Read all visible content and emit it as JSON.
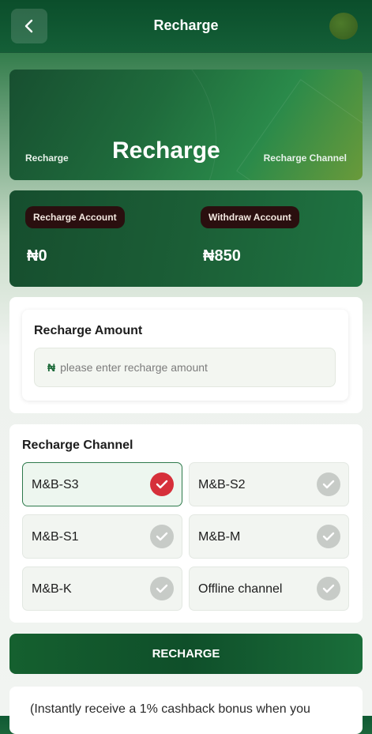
{
  "header": {
    "title": "Recharge"
  },
  "banner": {
    "left_label": "Recharge",
    "title": "Recharge",
    "right_label": "Recharge Channel"
  },
  "accounts": {
    "recharge": {
      "label": "Recharge Account",
      "value": "₦0"
    },
    "withdraw": {
      "label": "Withdraw Account",
      "value": "₦850"
    }
  },
  "amount": {
    "title": "Recharge Amount",
    "currency": "₦",
    "placeholder": "please enter recharge amount"
  },
  "channels": {
    "title": "Recharge Channel",
    "selected": "M&B-S3",
    "options": [
      {
        "label": "M&B-S3"
      },
      {
        "label": "M&B-S2"
      },
      {
        "label": "M&B-S1"
      },
      {
        "label": "M&B-M"
      },
      {
        "label": "M&B-K"
      },
      {
        "label": "Offline channel"
      }
    ]
  },
  "button": {
    "label": "RECHARGE"
  },
  "note": {
    "text": "(Instantly receive a 1% cashback bonus when you"
  },
  "colors": {
    "brand": "#0f5a33",
    "accent_selected": "#d6303a",
    "pill": "#2a0f0f"
  }
}
